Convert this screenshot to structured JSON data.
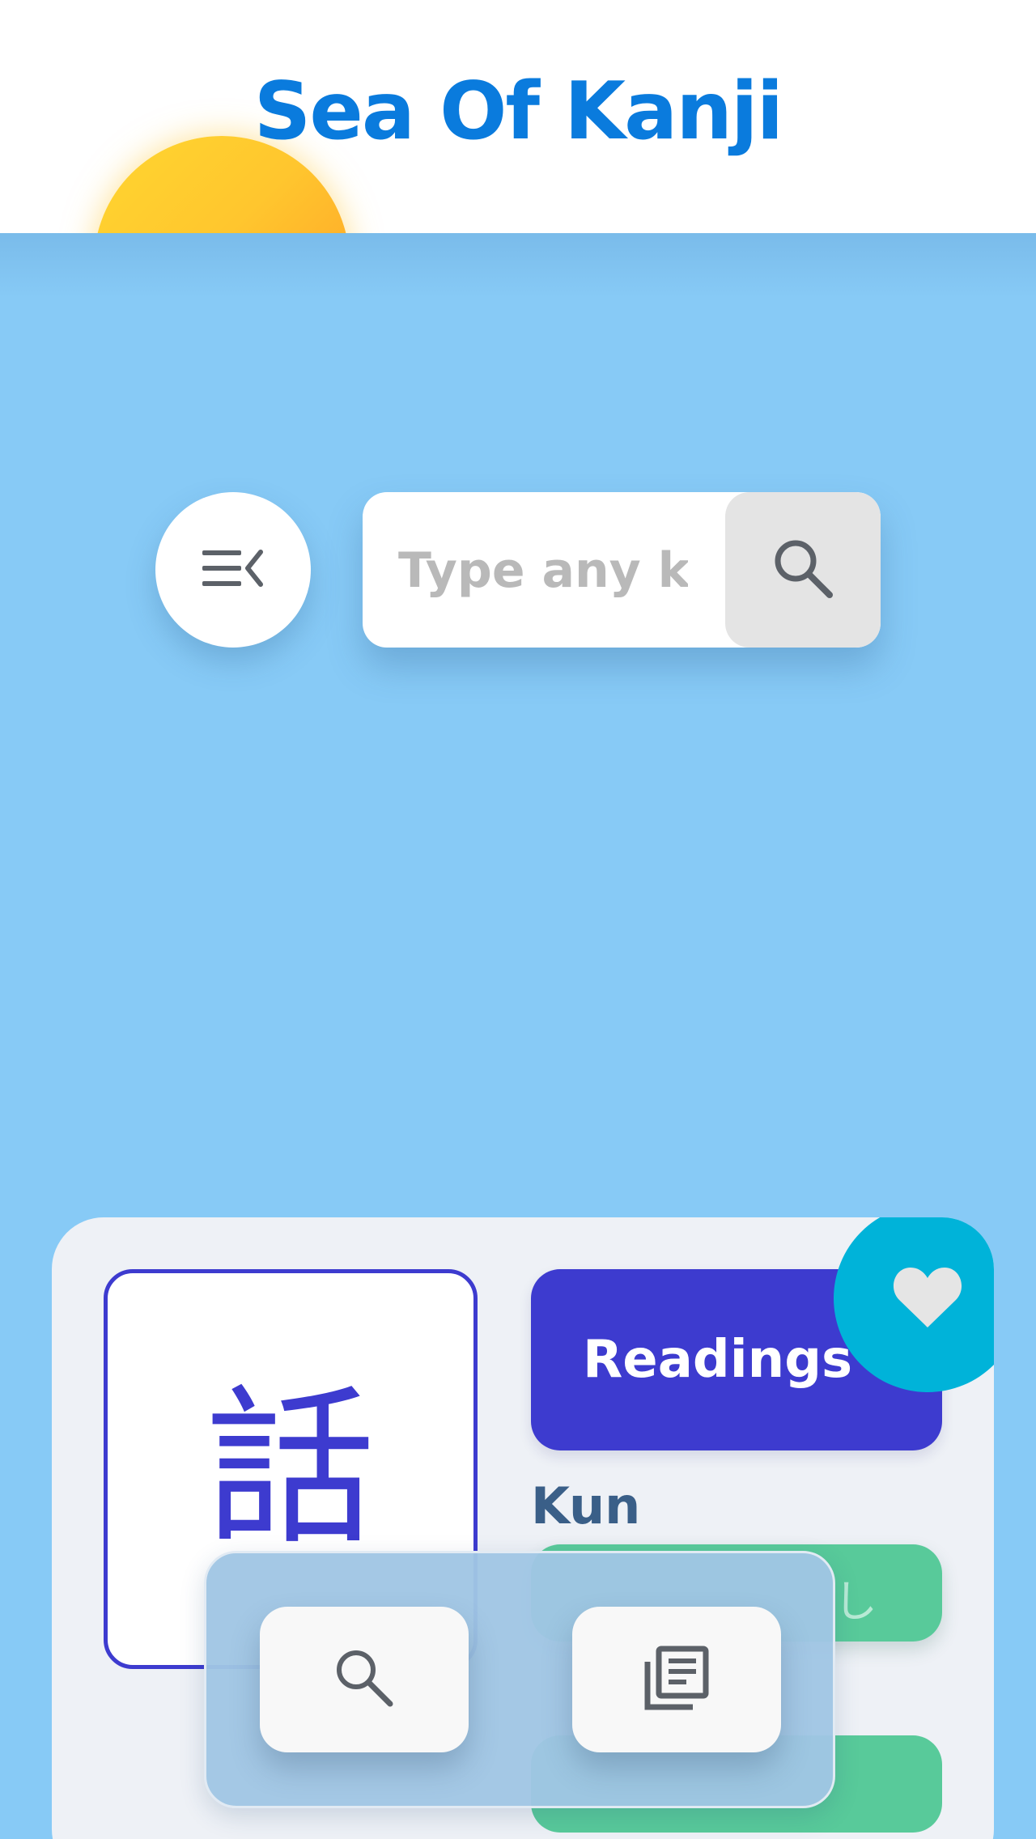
{
  "header": {
    "title": "Sea Of Kanji"
  },
  "search": {
    "placeholder": "Type any kanji",
    "value": ""
  },
  "icons": {
    "menu": "menu-collapse-icon",
    "search": "search-icon",
    "favorite": "heart-icon",
    "news": "newspaper-icon"
  },
  "kanji_card": {
    "kanji": "話",
    "readings_label": "Readings",
    "kun_label": "Kun",
    "kun_reading_visible": "し"
  },
  "colors": {
    "sky": "#87CAF6",
    "title": "#0A7BDD",
    "accent": "#3D3BCF",
    "favorite": "#00B3D9",
    "reading_pill": "#58CA9A",
    "kun_label": "#3A5F88"
  }
}
